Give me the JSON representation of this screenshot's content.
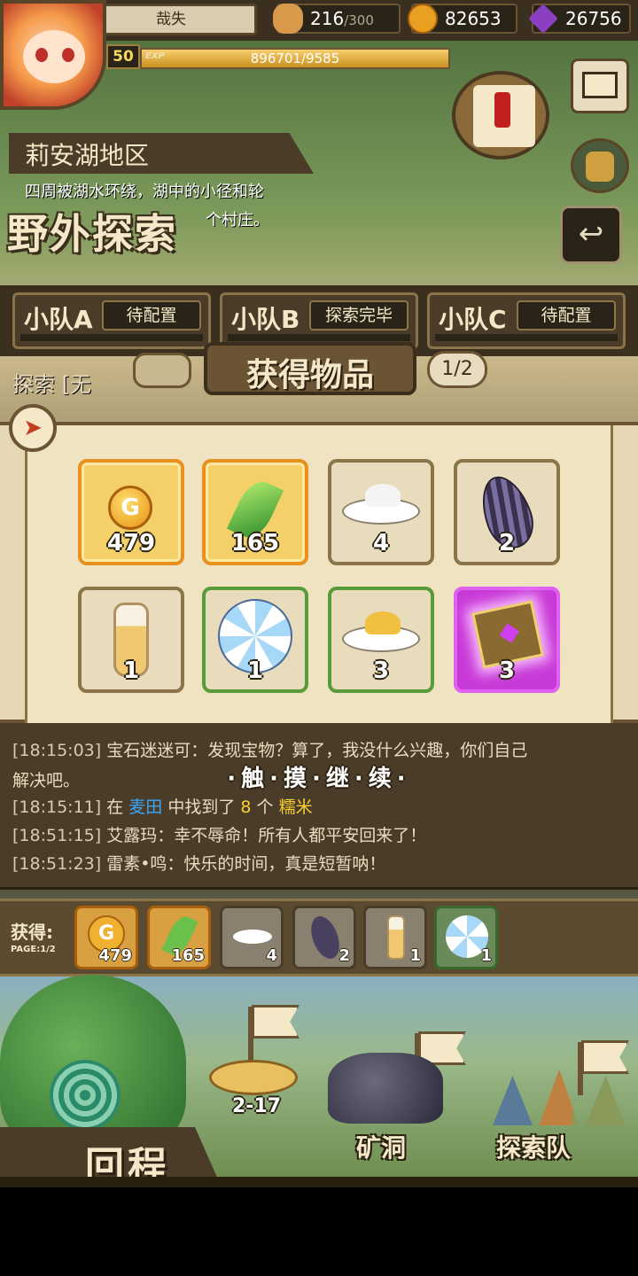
{
  "player": {
    "name": "哉失",
    "level": "50",
    "exp_label": "EXP",
    "exp_text": "896701/9585",
    "exp_fill_fraction": 1.0
  },
  "resources": {
    "stamina": {
      "value": "216",
      "max": "/300",
      "icon": "bread-icon"
    },
    "gold": {
      "value": "82653",
      "icon": "gold-coin-icon"
    },
    "gems": {
      "value": "26756",
      "icon": "purple-gem-icon"
    }
  },
  "region": {
    "name": "莉安湖地区",
    "desc_line1": "四周被湖水环绕，湖中的小径和轮",
    "desc_line2": "个村庄。",
    "mode_title": "野外探索"
  },
  "squads": [
    {
      "name": "小队A",
      "status": "待配置"
    },
    {
      "name": "小队B",
      "status": "探索完毕"
    },
    {
      "name": "小队C",
      "status": "待配置"
    }
  ],
  "explore_line": "探索 [无",
  "reward_panel": {
    "title": "获得物品",
    "page": "1/2",
    "items": [
      {
        "icon": "gold-coin-icon",
        "qty": "479",
        "rarity": "gold"
      },
      {
        "icon": "green-feather-icon",
        "qty": "165",
        "rarity": "gold"
      },
      {
        "icon": "white-powder-icon",
        "qty": "4",
        "rarity": "common"
      },
      {
        "icon": "purple-seed-icon",
        "qty": "2",
        "rarity": "common"
      },
      {
        "icon": "oil-bottle-icon",
        "qty": "1",
        "rarity": "common"
      },
      {
        "icon": "blue-flower-icon",
        "qty": "1",
        "rarity": "green"
      },
      {
        "icon": "yellow-powder-icon",
        "qty": "3",
        "rarity": "green"
      },
      {
        "icon": "spell-book-icon",
        "qty": "3",
        "rarity": "purple"
      }
    ]
  },
  "log": {
    "lines": [
      {
        "ts": "[18:15:03]",
        "text": "宝石迷迷可：发现宝物？算了，我没什么兴趣，你们自己"
      },
      {
        "ts": "",
        "text": "解决吧。"
      },
      {
        "ts": "[18:15:11]",
        "pre": "在",
        "loc": "麦田",
        "mid": "中找到了",
        "num": "8",
        "unit": "个",
        "item": "糯米"
      },
      {
        "ts": "[18:51:15]",
        "text": "艾露玛：幸不辱命！所有人都平安回来了！"
      },
      {
        "ts": "[18:51:23]",
        "text": "雷素•鸣：快乐的时间，真是短暂呐！"
      }
    ],
    "touch_continue": "·触·摸·继·续·"
  },
  "obtained": {
    "label": "获得:",
    "page": "PAGE:1/2",
    "items": [
      {
        "icon": "gold-coin-icon",
        "qty": "479"
      },
      {
        "icon": "green-feather-icon",
        "qty": "165"
      },
      {
        "icon": "white-powder-icon",
        "qty": "4"
      },
      {
        "icon": "purple-seed-icon",
        "qty": "2"
      },
      {
        "icon": "oil-bottle-icon",
        "qty": "1"
      },
      {
        "icon": "blue-flower-icon",
        "qty": "1"
      }
    ]
  },
  "map": {
    "stage": "2-17",
    "return_label": "回程",
    "mine_label": "矿洞",
    "team_label": "探索队"
  }
}
